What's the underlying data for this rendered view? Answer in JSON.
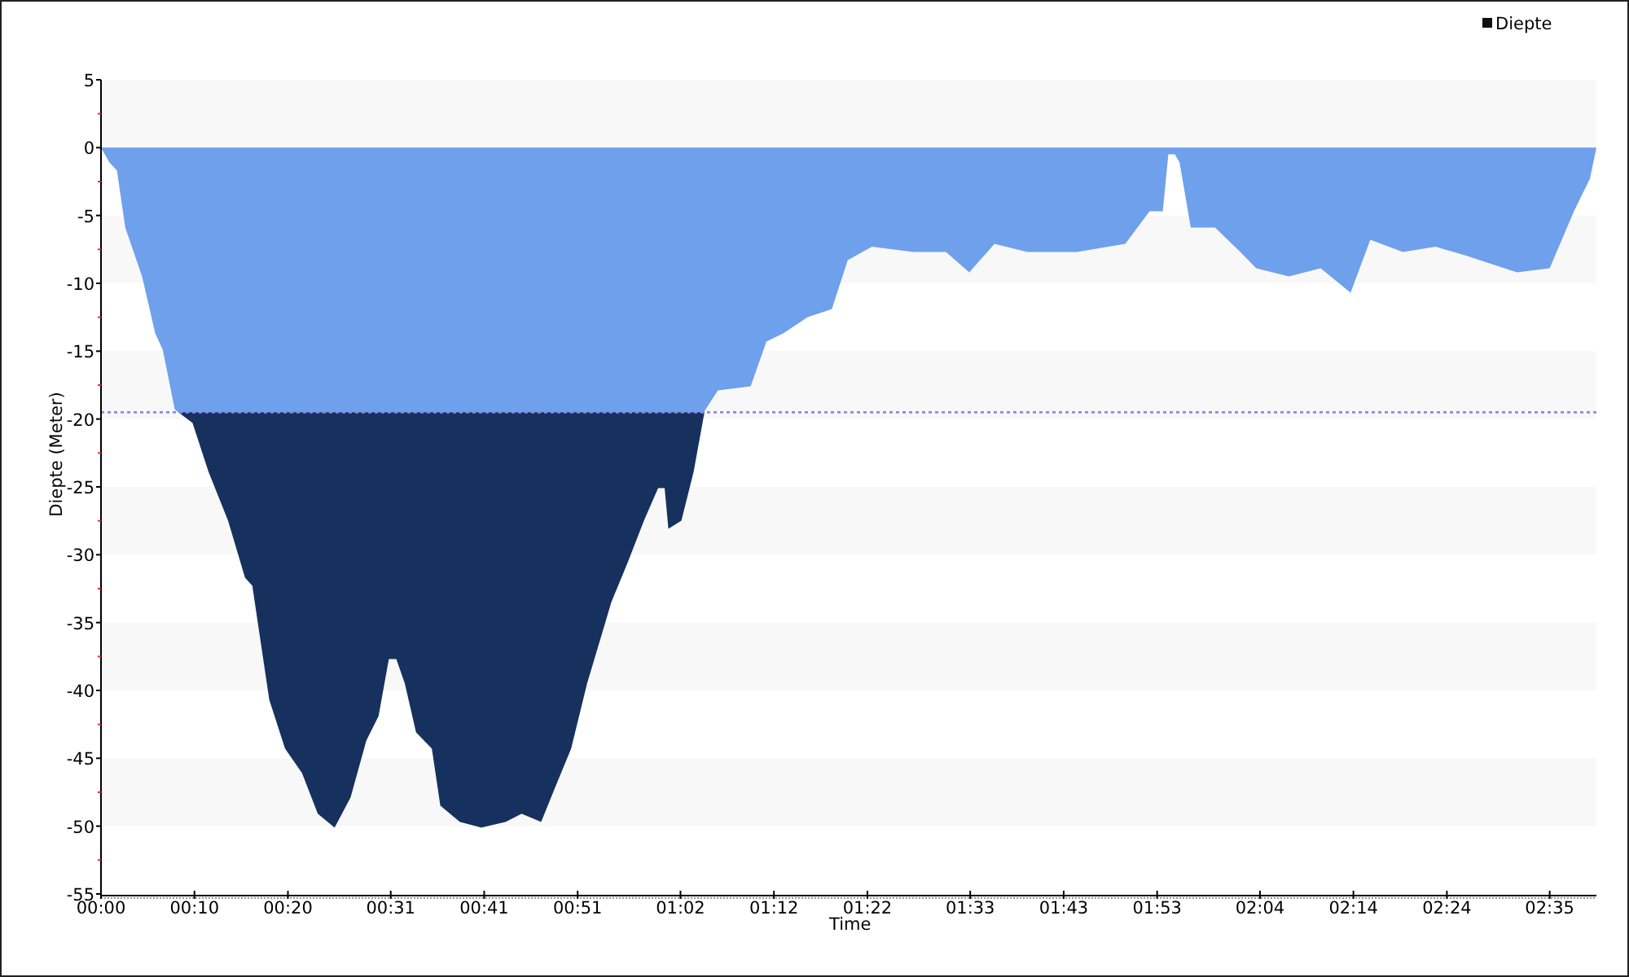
{
  "chart_data": {
    "type": "area",
    "xlabel": "Time",
    "ylabel": "Diepte (Meter)",
    "xlim": [
      0,
      160
    ],
    "ylim": [
      -55,
      5
    ],
    "xticks": [
      {
        "value": 0,
        "label": "00:00"
      },
      {
        "value": 10,
        "label": "00:10"
      },
      {
        "value": 20,
        "label": "00:20"
      },
      {
        "value": 31,
        "label": "00:31"
      },
      {
        "value": 41,
        "label": "00:41"
      },
      {
        "value": 51,
        "label": "00:51"
      },
      {
        "value": 62,
        "label": "01:02"
      },
      {
        "value": 72,
        "label": "01:12"
      },
      {
        "value": 82,
        "label": "01:22"
      },
      {
        "value": 93,
        "label": "01:33"
      },
      {
        "value": 103,
        "label": "01:43"
      },
      {
        "value": 113,
        "label": "01:53"
      },
      {
        "value": 124,
        "label": "02:04"
      },
      {
        "value": 134,
        "label": "02:14"
      },
      {
        "value": 144,
        "label": "02:24"
      },
      {
        "value": 155,
        "label": "02:35"
      }
    ],
    "yticks": [
      5,
      0,
      -5,
      -10,
      -15,
      -20,
      -25,
      -30,
      -35,
      -40,
      -45,
      -50,
      -55
    ],
    "x": [
      0,
      0.9,
      1.7,
      2.6,
      4.4,
      5.8,
      6.6,
      7.9,
      9.8,
      11.5,
      13.6,
      15.4,
      16.2,
      18,
      19.7,
      21.5,
      23.2,
      25,
      26.7,
      28.4,
      29.7,
      30.8,
      31.6,
      32.5,
      33.7,
      35.4,
      36.3,
      38.4,
      40.7,
      43.3,
      45,
      47.1,
      48.5,
      50.3,
      52,
      54.6,
      56.4,
      58.1,
      59.6,
      60.3,
      60.7,
      62.1,
      63.4,
      64.6,
      66,
      69.5,
      71.2,
      73,
      75.6,
      78.2,
      79.9,
      82.5,
      86.9,
      90.4,
      92.9,
      95.6,
      99.1,
      104.4,
      109.6,
      112.2,
      113.6,
      114.2,
      114.9,
      115.4,
      116.6,
      119.2,
      121.9,
      123.6,
      127.1,
      130.5,
      133.7,
      135.8,
      139.3,
      142.8,
      146.2,
      151.5,
      155,
      157.6,
      159.3,
      160
    ],
    "series": [
      {
        "name": "Diepte",
        "color": "#6fa0eb",
        "values": [
          0,
          -1.1,
          -1.7,
          -5.9,
          -9.5,
          -13.7,
          -14.9,
          -19.3,
          -20.3,
          -23.9,
          -27.5,
          -31.7,
          -32.3,
          -40.7,
          -44.3,
          -46.1,
          -49.1,
          -50.1,
          -47.9,
          -43.7,
          -41.9,
          -37.7,
          -37.7,
          -39.5,
          -43.1,
          -44.3,
          -48.5,
          -49.7,
          -50.1,
          -49.7,
          -49.1,
          -49.7,
          -47.3,
          -44.3,
          -39.5,
          -33.5,
          -30.5,
          -27.5,
          -25.1,
          -25.1,
          -28.1,
          -27.5,
          -23.9,
          -19.4,
          -17.9,
          -17.6,
          -14.3,
          -13.7,
          -12.5,
          -11.9,
          -8.3,
          -7.3,
          -7.7,
          -7.7,
          -9.2,
          -7.1,
          -7.7,
          -7.7,
          -7.1,
          -4.7,
          -4.7,
          -0.5,
          -0.5,
          -1.1,
          -5.9,
          -5.9,
          -7.7,
          -8.9,
          -9.5,
          -8.9,
          -10.7,
          -6.8,
          -7.7,
          -7.3,
          -8,
          -9.2,
          -8.9,
          -4.7,
          -2.3,
          0
        ]
      }
    ],
    "ref_lines": [
      {
        "axis": "y",
        "value": -19.5,
        "color": "#8888ff"
      }
    ]
  }
}
